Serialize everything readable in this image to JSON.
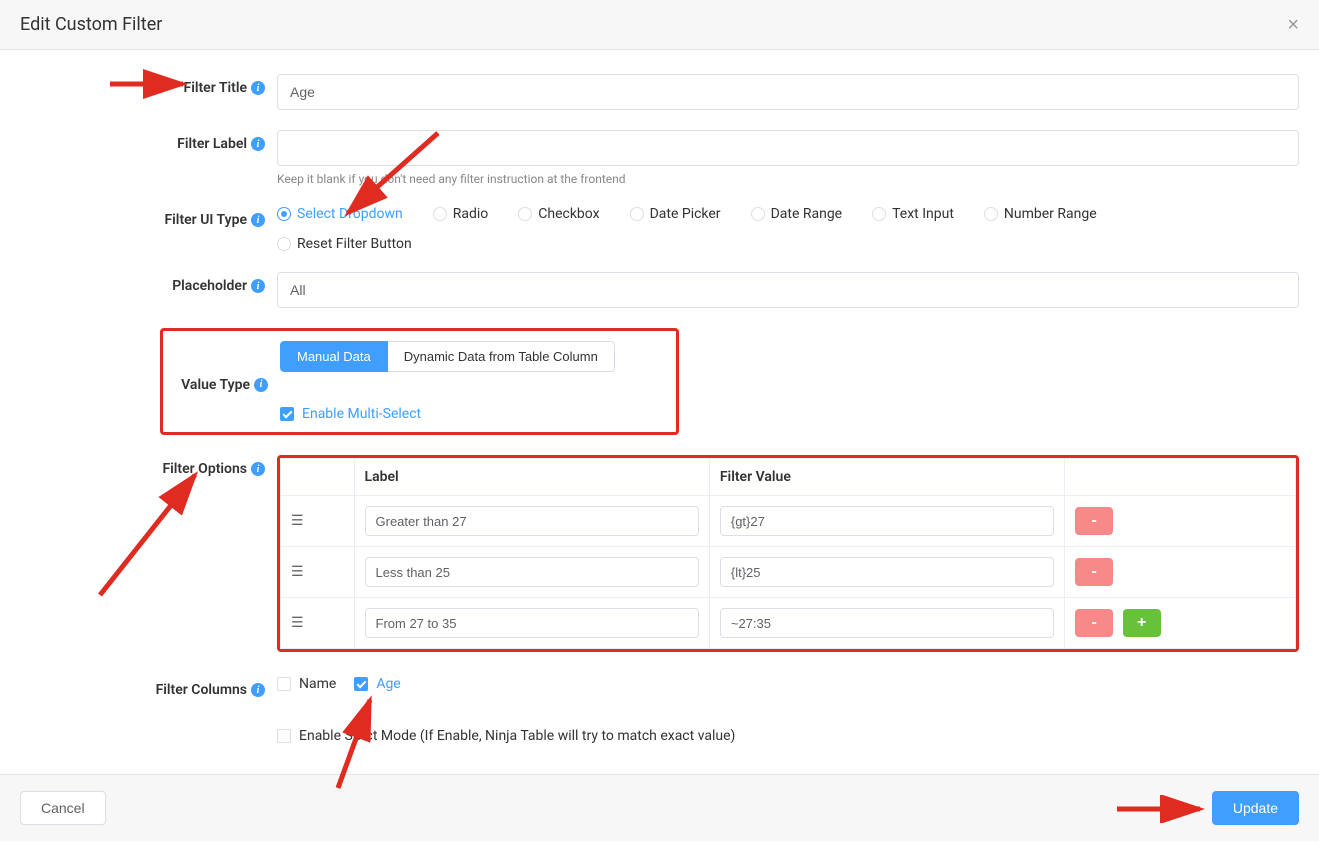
{
  "header": {
    "title": "Edit Custom Filter"
  },
  "labels": {
    "filter_title": "Filter Title",
    "filter_label": "Filter Label",
    "filter_ui_type": "Filter UI Type",
    "placeholder": "Placeholder",
    "value_type": "Value Type",
    "filter_options": "Filter Options",
    "filter_columns": "Filter Columns"
  },
  "filter_title": {
    "value": "Age"
  },
  "filter_label": {
    "value": "",
    "helper": "Keep it blank if you don't need any filter instruction at the frontend"
  },
  "ui_types": {
    "select_dropdown": "Select Dropdown",
    "radio": "Radio",
    "checkbox": "Checkbox",
    "date_picker": "Date Picker",
    "date_range": "Date Range",
    "text_input": "Text Input",
    "number_range": "Number Range",
    "reset_filter": "Reset Filter Button"
  },
  "placeholder": {
    "value": "All"
  },
  "value_type": {
    "manual": "Manual Data",
    "dynamic": "Dynamic Data from Table Column",
    "enable_multi": "Enable Multi-Select"
  },
  "options_table": {
    "header_label": "Label",
    "header_value": "Filter Value",
    "rows": [
      {
        "label": "Greater than 27",
        "value": "{gt}27"
      },
      {
        "label": "Less than 25",
        "value": "{lt}25"
      },
      {
        "label": "From 27 to 35",
        "value": "~27:35"
      }
    ]
  },
  "columns": {
    "name": "Name",
    "age": "Age"
  },
  "strict_mode": "Enable Strict Mode (If Enable, Ninja Table will try to match exact value)",
  "footer": {
    "cancel": "Cancel",
    "update": "Update"
  }
}
